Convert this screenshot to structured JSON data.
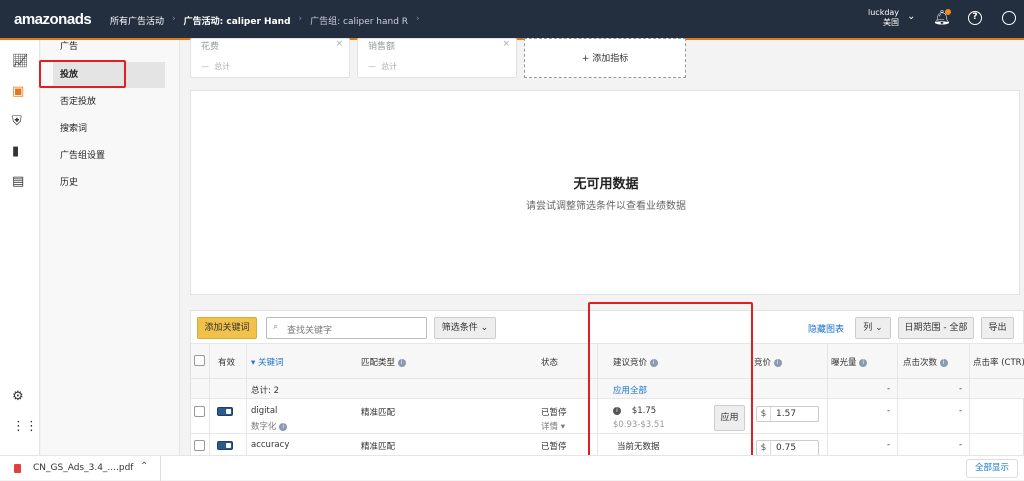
{
  "header": {
    "logo": "amazonads",
    "breadcrumbs": [
      "所有广告活动",
      "广告活动: caliper Hand",
      "广告组: caliper hand R"
    ],
    "user": "luckday",
    "region": "美国"
  },
  "subnav": [
    "广告",
    "投放",
    "否定投放",
    "搜索词",
    "广告组设置",
    "历史"
  ],
  "metrics": [
    {
      "label": "花费",
      "total": "总计"
    },
    {
      "label": "销售额",
      "total": "总计"
    }
  ],
  "add_metric": "+ 添加指标",
  "empty": {
    "title": "无可用数据",
    "subtitle": "请尝试调整筛选条件以查看业绩数据"
  },
  "toolbar": {
    "add_keyword": "添加关键词",
    "search_placeholder": "查找关键字",
    "filter": "筛选条件",
    "hide_chart": "隐藏图表",
    "columns": "列",
    "date_range": "日期范围 - 全部",
    "export": "导出"
  },
  "columns": [
    "有效",
    "▾ 关键词",
    "匹配类型",
    "状态",
    "建议竞价",
    "竞价",
    "曝光量",
    "点击次数",
    "点击率 (CTR)"
  ],
  "total_row": {
    "label": "总计: 2",
    "apply_all": "应用全部",
    "impr": "-",
    "clicks": "-"
  },
  "rows": [
    {
      "keyword": "digital",
      "translation": "数字化",
      "match": "精准匹配",
      "status": "已暂停",
      "detail": "详情 ▾",
      "suggested": "$1.75",
      "range": "$0.93-$3.51",
      "apply": "应用",
      "currency": "$",
      "bid": "1.57",
      "impr": "-",
      "clicks": "-"
    },
    {
      "keyword": "accuracy",
      "match": "精准匹配",
      "status": "已暂停",
      "suggested_none": "当前无数据",
      "currency": "$",
      "bid": "0.75",
      "impr": "-",
      "clicks": "-"
    }
  ],
  "download": {
    "file": "CN_GS_Ads_3.4_....pdf",
    "show_all": "全部显示"
  },
  "colors": {
    "header": "#232f3e",
    "accent": "#e3781a",
    "highlight": "#e02020",
    "primary_btn": "#f0c14b"
  }
}
